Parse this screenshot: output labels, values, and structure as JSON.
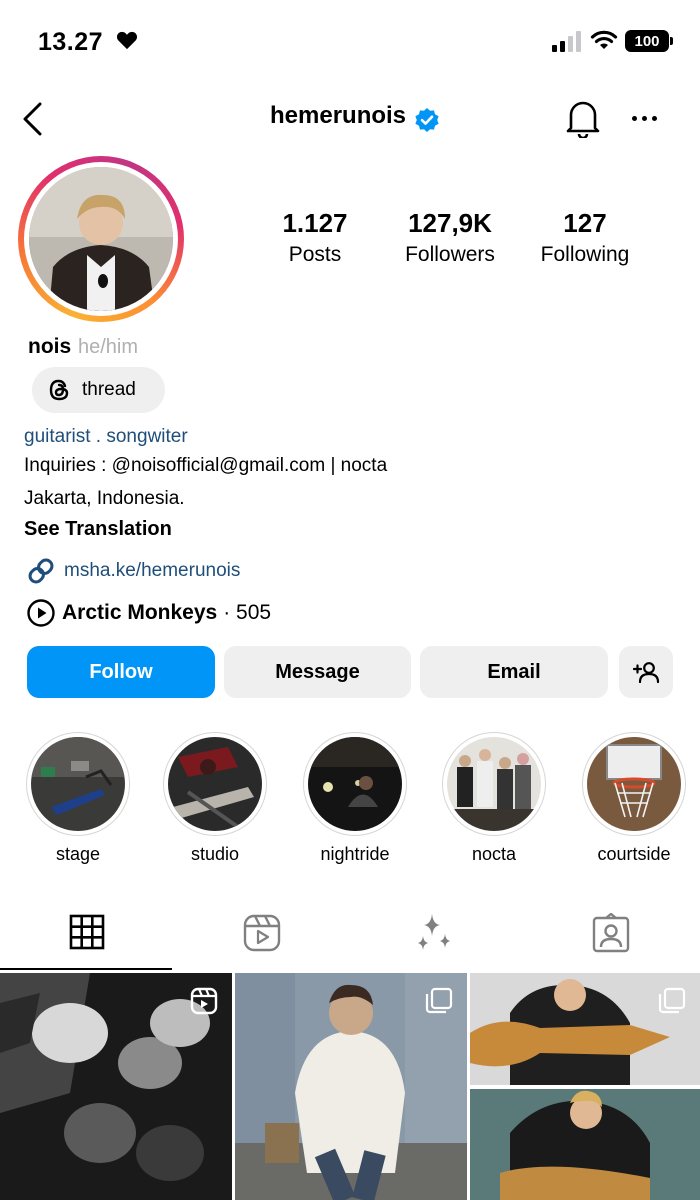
{
  "status_bar": {
    "time": "13.27",
    "battery": "100"
  },
  "header": {
    "username": "hemerunois"
  },
  "profile": {
    "stats": [
      {
        "value": "1.127",
        "label": "Posts"
      },
      {
        "value": "127,9K",
        "label": "Followers"
      },
      {
        "value": "127",
        "label": "Following"
      }
    ],
    "display_name": "nois",
    "pronouns": "he/him",
    "threads_label": "thread",
    "category": "guitarist . songwiter",
    "bio_lines": [
      "Inquiries : @noisofficial@gmail.com | nocta",
      "Jakarta, Indonesia."
    ],
    "see_translation": "See Translation",
    "link": "msha.ke/hemerunois",
    "music": {
      "artist": "Arctic Monkeys",
      "count": "· 505"
    }
  },
  "actions": {
    "follow": "Follow",
    "message": "Message",
    "email": "Email"
  },
  "highlights": [
    {
      "label": "stage"
    },
    {
      "label": "studio"
    },
    {
      "label": "nightride"
    },
    {
      "label": "nocta"
    },
    {
      "label": "courtside"
    }
  ],
  "tabs": [
    "grid-icon",
    "reels-icon",
    "sparkles-icon",
    "tagged-icon"
  ],
  "colors": {
    "accent": "#0095f6",
    "link": "#1f4e7a",
    "verified": "#0095f6",
    "button_gray": "#efefef"
  }
}
